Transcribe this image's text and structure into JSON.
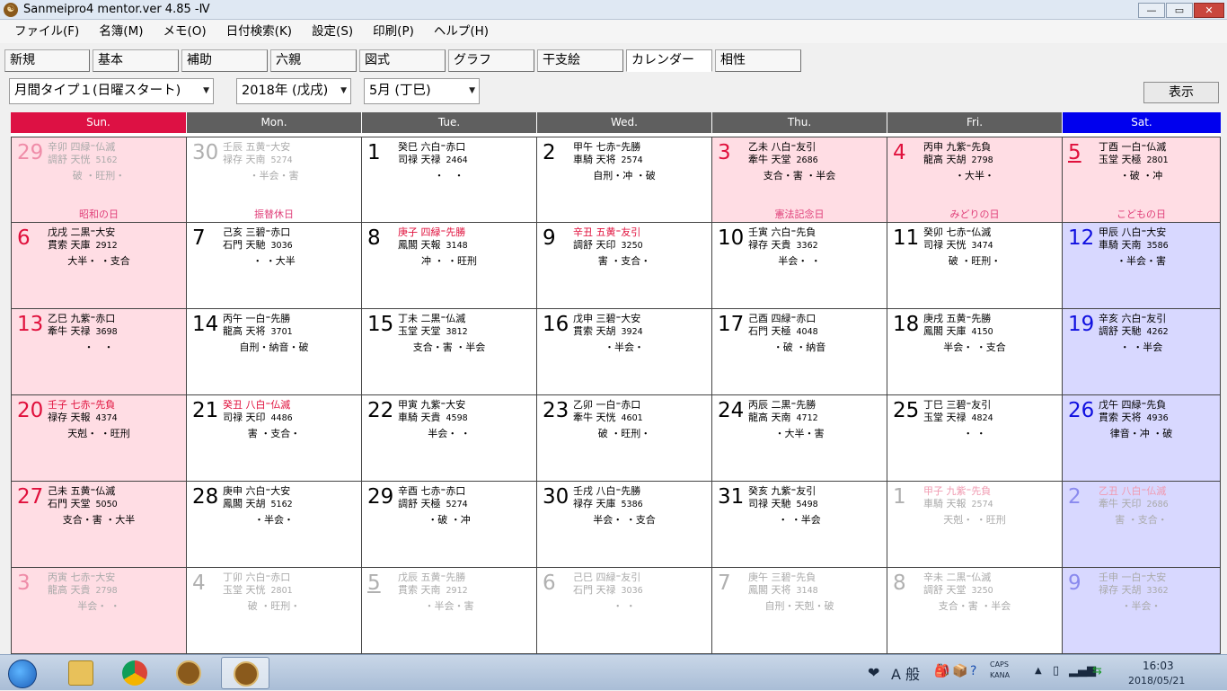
{
  "window": {
    "title": "Sanmeipro4 mentor.ver 4.85 -Ⅳ",
    "min": "—",
    "max": "▭",
    "close": "✕"
  },
  "menu": [
    "ファイル(F)",
    "名簿(M)",
    "メモ(O)",
    "日付検索(K)",
    "設定(S)",
    "印刷(P)",
    "ヘルプ(H)"
  ],
  "tabs": [
    "新規",
    "基本",
    "補助",
    "六親",
    "図式",
    "グラフ",
    "干支絵",
    "カレンダー",
    "相性"
  ],
  "active_tab": "カレンダー",
  "controls": {
    "type_select": "月間タイプ１(日曜スタート)",
    "year_select": "2018年 (戊戌)",
    "month_select": "5月 (丁巳)",
    "show_button": "表示"
  },
  "colors": {
    "sun_header": "#dd1144",
    "sat_header": "#0000ee",
    "weekday_header": "#5f5f5f",
    "sun_bg": "#ffdde4",
    "sat_bg": "#d8d8ff",
    "red_text": "#e0103c",
    "blue_text": "#1010e0",
    "gray_text": "#aaaaaa"
  },
  "weekdays": [
    "Sun.",
    "Mon.",
    "Tue.",
    "Wed.",
    "Thu.",
    "Fri.",
    "Sat."
  ],
  "weeks": [
    [
      {
        "d": "29",
        "l1": "辛卯 四緑⁼仏滅",
        "l2": "調舒 天恍",
        "n": "5162",
        "l3": "破 ・旺刑・",
        "hol": "昭和の日",
        "other": true
      },
      {
        "d": "30",
        "l1": "壬辰 五黄⁼大安",
        "l2": "禄存 天南",
        "n": "5274",
        "l3": "・半会・害",
        "hol": "振替休日",
        "other": true
      },
      {
        "d": "1",
        "l1": "癸巳 六白⁼赤口",
        "l2": "司禄 天禄",
        "n": "2464",
        "l3": "・　・",
        "hol": ""
      },
      {
        "d": "2",
        "l1": "甲午 七赤⁼先勝",
        "l2": "車騎 天将",
        "n": "2574",
        "l3": "自刑・冲 ・破",
        "hol": ""
      },
      {
        "d": "3",
        "l1": "乙未 八白⁼友引",
        "l2": "牽牛 天堂",
        "n": "2686",
        "l3": "支合・害 ・半会",
        "hol": "憲法記念日",
        "holiday": true
      },
      {
        "d": "4",
        "l1": "丙申 九紫⁼先負",
        "l2": "龍高 天胡",
        "n": "2798",
        "l3": "・大半・",
        "hol": "みどりの日",
        "holiday": true
      },
      {
        "d": "5",
        "l1": "丁酉 一白⁼仏滅",
        "l2": "玉堂 天極",
        "n": "2801",
        "l3": "・破 ・冲",
        "hol": "こどもの日",
        "holiday": true,
        "underline": true
      }
    ],
    [
      {
        "d": "6",
        "l1": "戊戌 二黒⁼大安",
        "l2": "貫索 天庫",
        "n": "2912",
        "l3": "大半・ ・支合",
        "hol": ""
      },
      {
        "d": "7",
        "l1": "己亥 三碧⁼赤口",
        "l2": "石門 天馳",
        "n": "3036",
        "l3": "・ ・大半",
        "hol": ""
      },
      {
        "d": "8",
        "l1": "庚子 四緑⁼先勝",
        "l2": "鳳閣 天報",
        "n": "3148",
        "l3": "冲 ・ ・旺刑",
        "hol": "",
        "redl1": true
      },
      {
        "d": "9",
        "l1": "辛丑 五黄⁼友引",
        "l2": "調舒 天印",
        "n": "3250",
        "l3": "害 ・支合・",
        "hol": "",
        "redl1": true
      },
      {
        "d": "10",
        "l1": "壬寅 六白⁼先負",
        "l2": "禄存 天貴",
        "n": "3362",
        "l3": "半会・ ・",
        "hol": ""
      },
      {
        "d": "11",
        "l1": "癸卯 七赤⁼仏滅",
        "l2": "司禄 天恍",
        "n": "3474",
        "l3": "破 ・旺刑・",
        "hol": ""
      },
      {
        "d": "12",
        "l1": "甲辰 八白⁼大安",
        "l2": "車騎 天南",
        "n": "3586",
        "l3": "・半会・害",
        "hol": ""
      }
    ],
    [
      {
        "d": "13",
        "l1": "乙巳 九紫⁼赤口",
        "l2": "牽牛 天禄",
        "n": "3698",
        "l3": "・　・",
        "hol": ""
      },
      {
        "d": "14",
        "l1": "丙午 一白⁼先勝",
        "l2": "龍高 天将",
        "n": "3701",
        "l3": "自刑・納音・破",
        "hol": ""
      },
      {
        "d": "15",
        "l1": "丁未 二黒⁼仏滅",
        "l2": "玉堂 天堂",
        "n": "3812",
        "l3": "支合・害 ・半会",
        "hol": ""
      },
      {
        "d": "16",
        "l1": "戊申 三碧⁼大安",
        "l2": "貫索 天胡",
        "n": "3924",
        "l3": "・半会・",
        "hol": ""
      },
      {
        "d": "17",
        "l1": "己酉 四緑⁼赤口",
        "l2": "石門 天極",
        "n": "4048",
        "l3": "・破 ・納音",
        "hol": ""
      },
      {
        "d": "18",
        "l1": "庚戌 五黄⁼先勝",
        "l2": "鳳閣 天庫",
        "n": "4150",
        "l3": "半会・ ・支合",
        "hol": ""
      },
      {
        "d": "19",
        "l1": "辛亥 六白⁼友引",
        "l2": "調舒 天馳",
        "n": "4262",
        "l3": "・ ・半会",
        "hol": ""
      }
    ],
    [
      {
        "d": "20",
        "l1": "壬子 七赤⁼先負",
        "l2": "禄存 天報",
        "n": "4374",
        "l3": "天剋・ ・旺刑",
        "hol": "",
        "redl1": true
      },
      {
        "d": "21",
        "l1": "癸丑 八白⁼仏滅",
        "l2": "司禄 天印",
        "n": "4486",
        "l3": "害 ・支合・",
        "hol": "",
        "redl1": true
      },
      {
        "d": "22",
        "l1": "甲寅 九紫⁼大安",
        "l2": "車騎 天貴",
        "n": "4598",
        "l3": "半会・ ・",
        "hol": ""
      },
      {
        "d": "23",
        "l1": "乙卯 一白⁼赤口",
        "l2": "牽牛 天恍",
        "n": "4601",
        "l3": "破 ・旺刑・",
        "hol": ""
      },
      {
        "d": "24",
        "l1": "丙辰 二黒⁼先勝",
        "l2": "龍高 天南",
        "n": "4712",
        "l3": "・大半・害",
        "hol": ""
      },
      {
        "d": "25",
        "l1": "丁巳 三碧⁼友引",
        "l2": "玉堂 天禄",
        "n": "4824",
        "l3": "・ ・",
        "hol": ""
      },
      {
        "d": "26",
        "l1": "戊午 四緑⁼先負",
        "l2": "貫索 天将",
        "n": "4936",
        "l3": "律音・冲 ・破",
        "hol": ""
      }
    ],
    [
      {
        "d": "27",
        "l1": "己未 五黄⁼仏滅",
        "l2": "石門 天堂",
        "n": "5050",
        "l3": "支合・害 ・大半",
        "hol": ""
      },
      {
        "d": "28",
        "l1": "庚申 六白⁼大安",
        "l2": "鳳閣 天胡",
        "n": "5162",
        "l3": "・半会・",
        "hol": ""
      },
      {
        "d": "29",
        "l1": "辛酉 七赤⁼赤口",
        "l2": "調舒 天極",
        "n": "5274",
        "l3": "・破 ・冲",
        "hol": ""
      },
      {
        "d": "30",
        "l1": "壬戌 八白⁼先勝",
        "l2": "禄存 天庫",
        "n": "5386",
        "l3": "半会・ ・支合",
        "hol": ""
      },
      {
        "d": "31",
        "l1": "癸亥 九紫⁼友引",
        "l2": "司禄 天馳",
        "n": "5498",
        "l3": "・ ・半会",
        "hol": ""
      },
      {
        "d": "1",
        "l1": "甲子 九紫⁼先負",
        "l2": "車騎 天報",
        "n": "2574",
        "l3": "天剋・ ・旺刑",
        "hol": "",
        "other": true,
        "redl1": true
      },
      {
        "d": "2",
        "l1": "乙丑 八白⁼仏滅",
        "l2": "牽牛 天印",
        "n": "2686",
        "l3": "害 ・支合・",
        "hol": "",
        "other": true,
        "redl1": true
      }
    ],
    [
      {
        "d": "3",
        "l1": "丙寅 七赤⁼大安",
        "l2": "龍高 天貴",
        "n": "2798",
        "l3": "半会・ ・",
        "hol": "",
        "other": true
      },
      {
        "d": "4",
        "l1": "丁卯 六白⁼赤口",
        "l2": "玉堂 天恍",
        "n": "2801",
        "l3": "破 ・旺刑・",
        "hol": "",
        "other": true
      },
      {
        "d": "5",
        "l1": "戊辰 五黄⁼先勝",
        "l2": "貫索 天南",
        "n": "2912",
        "l3": "・半会・害",
        "hol": "",
        "other": true,
        "underline": true
      },
      {
        "d": "6",
        "l1": "己巳 四緑⁼友引",
        "l2": "石門 天禄",
        "n": "3036",
        "l3": "・ ・",
        "hol": "",
        "other": true
      },
      {
        "d": "7",
        "l1": "庚午 三碧⁼先負",
        "l2": "鳳閣 天将",
        "n": "3148",
        "l3": "自刑・天剋・破",
        "hol": "",
        "other": true
      },
      {
        "d": "8",
        "l1": "辛未 二黒⁼仏滅",
        "l2": "調舒 天堂",
        "n": "3250",
        "l3": "支合・害 ・半会",
        "hol": "",
        "other": true
      },
      {
        "d": "9",
        "l1": "壬申 一白⁼大安",
        "l2": "禄存 天胡",
        "n": "3362",
        "l3": "・半会・",
        "hol": "",
        "other": true
      }
    ]
  ],
  "taskbar": {
    "ime_mode": "A 般",
    "caps": "CAPS",
    "kana": "KANA",
    "time": "16:03",
    "date": "2018/05/21"
  }
}
